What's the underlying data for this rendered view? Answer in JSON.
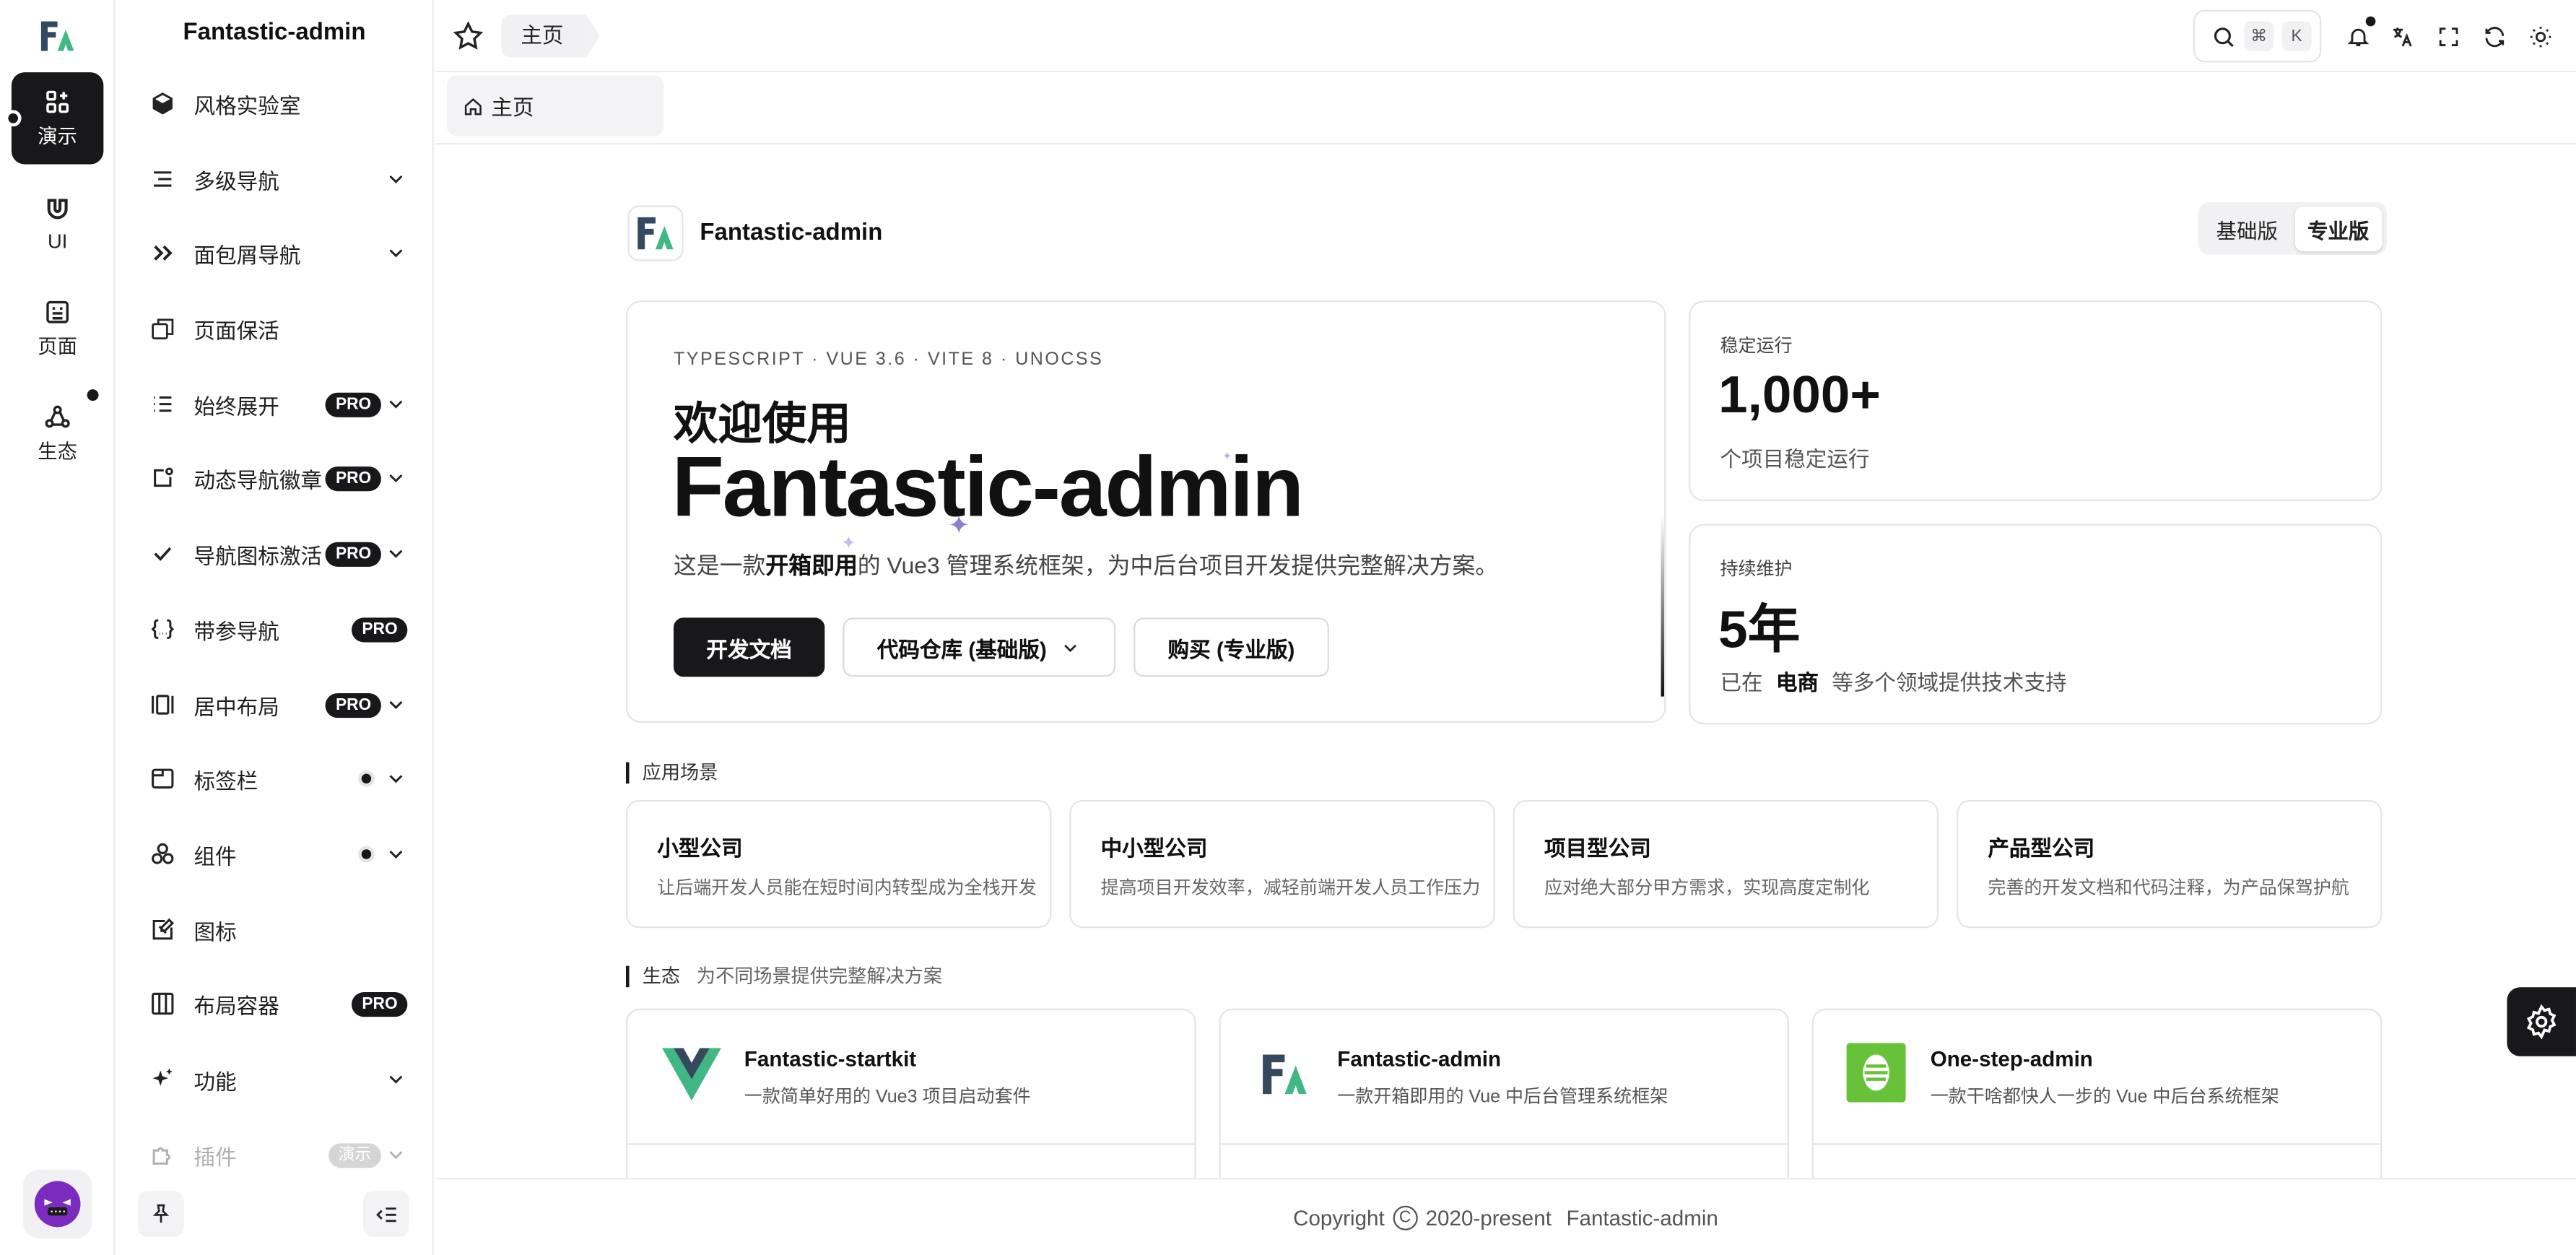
{
  "colors": {
    "primary": "#18181b",
    "brand_green": "#41b883",
    "brand_dark": "#34495e",
    "one_step_green": "#67c23a",
    "sparkle": "#8b7fd6"
  },
  "rail": {
    "items": [
      {
        "label": "演示",
        "icon": "grid-plus-icon"
      },
      {
        "label": "UI",
        "icon": "magnet-icon"
      },
      {
        "label": "页面",
        "icon": "page-icon"
      },
      {
        "label": "生态",
        "icon": "ecosystem-icon"
      }
    ]
  },
  "sidebar": {
    "title": "Fantastic-admin",
    "items": [
      {
        "label": "风格实验室",
        "icon": "cube-icon"
      },
      {
        "label": "多级导航",
        "icon": "list-indent-icon"
      },
      {
        "label": "面包屑导航",
        "icon": "double-chevron-icon"
      },
      {
        "label": "页面保活",
        "icon": "copy-icon"
      },
      {
        "label": "始终展开",
        "icon": "list-icon",
        "badge": "PRO"
      },
      {
        "label": "动态导航徽章",
        "icon": "badge-icon",
        "badge": "PRO"
      },
      {
        "label": "导航图标激活",
        "icon": "check-icon",
        "badge": "PRO"
      },
      {
        "label": "带参导航",
        "icon": "braces-icon",
        "badge": "PRO"
      },
      {
        "label": "居中布局",
        "icon": "center-layout-icon",
        "badge": "PRO"
      },
      {
        "label": "标签栏",
        "icon": "tab-window-icon"
      },
      {
        "label": "组件",
        "icon": "components-icon"
      },
      {
        "label": "图标",
        "icon": "icon-edit-icon"
      },
      {
        "label": "布局容器",
        "icon": "columns-icon",
        "badge": "PRO"
      },
      {
        "label": "功能",
        "icon": "sparkles-icon"
      },
      {
        "label": "插件",
        "icon": "puzzle-icon",
        "badge": "演示"
      }
    ]
  },
  "topbar": {
    "breadcrumb": "主页",
    "search_keys": [
      "⌘",
      "K"
    ]
  },
  "tabbar": {
    "tab_label": "主页"
  },
  "main": {
    "brand_name": "Fantastic-admin",
    "editions": [
      "基础版",
      "专业版"
    ],
    "hero": {
      "kicker": "TYPESCRIPT · VUE 3.6 · VITE 8 · UNOCSS",
      "welcome": "欢迎使用",
      "title": "Fantastic-admin",
      "desc_prefix": "这是一款",
      "desc_bold": "开箱即用",
      "desc_suffix": "的 Vue3 管理系统框架，为中后台项目开发提供完整解决方案。",
      "btn_docs": "开发文档",
      "btn_repo": "代码仓库 (基础版)",
      "btn_buy": "购买 (专业版)"
    },
    "stats": [
      {
        "label": "稳定运行",
        "value": "1,000+",
        "sub": "个项目稳定运行"
      },
      {
        "label": "持续维护",
        "value": "5年",
        "sub_prefix": "已在",
        "sub_bold": "电商",
        "sub_suffix": "等多个领域提供技术支持"
      }
    ],
    "scenes_title": "应用场景",
    "scenes": [
      {
        "name": "小型公司",
        "desc": "让后端开发人员能在短时间内转型成为全栈开发"
      },
      {
        "name": "中小型公司",
        "desc": "提高项目开发效率，减轻前端开发人员工作压力"
      },
      {
        "name": "项目型公司",
        "desc": "应对绝大部分甲方需求，实现高度定制化"
      },
      {
        "name": "产品型公司",
        "desc": "完善的开发文档和代码注释，为产品保驾护航"
      }
    ],
    "eco_title": "生态",
    "eco_subtitle": "为不同场景提供完整解决方案",
    "eco": [
      {
        "name": "Fantastic-startkit",
        "desc": "一款简单好用的 Vue3 项目启动套件"
      },
      {
        "name": "Fantastic-admin",
        "desc": "一款开箱即用的 Vue 中后台管理系统框架"
      },
      {
        "name": "One-step-admin",
        "desc": "一款干啥都快人一步的 Vue 中后台系统框架"
      }
    ]
  },
  "footer": {
    "copyright": "Copyright",
    "symbol": "©",
    "years": "2020-present",
    "owner": "Fantastic-admin"
  }
}
